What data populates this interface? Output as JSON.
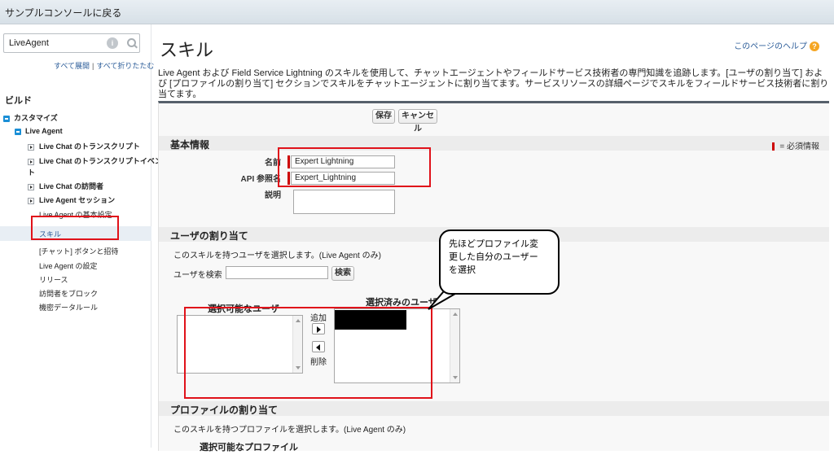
{
  "topbar": {
    "back_link": "サンプルコンソールに戻る"
  },
  "sidebar": {
    "search_value": "LiveAgent",
    "expand_all": "すべて展開",
    "separator": "|",
    "collapse_all": "すべて折りたたむ",
    "build_title": "ビルド",
    "customize": "カスタマイズ",
    "live_agent": "Live Agent",
    "items": [
      {
        "label": "Live Chat のトランスクリプト"
      },
      {
        "label": "Live Chat のトランスクリプトイベン"
      },
      {
        "label": "ト"
      },
      {
        "label": "Live Chat の訪問者"
      },
      {
        "label": "Live Agent セッション"
      },
      {
        "label": "Live Agent の基本設定"
      },
      {
        "label": "スキル"
      },
      {
        "label": "[チャット] ボタンと招待"
      },
      {
        "label": "Live Agent の設定"
      },
      {
        "label": "リリース"
      },
      {
        "label": "訪問者をブロック"
      },
      {
        "label": "機密データルール"
      }
    ]
  },
  "main": {
    "title": "スキル",
    "help_link": "このページのヘルプ",
    "description": "Live Agent および Field Service Lightning のスキルを使用して、チャットエージェントやフィールドサービス技術者の専門知識を追跡します。[ユーザの割り当て] および [プロファイルの割り当て] セクションでスキルをチャットエージェントに割り当てます。サービスリソースの詳細ページでスキルをフィールドサービス技術者に割り当てます。",
    "save_button": "保存",
    "cancel_button": "キャンセル",
    "basic_info": {
      "heading": "基本情報",
      "required_legend": "= 必須情報",
      "name_label": "名前",
      "name_value": "Expert Lightning",
      "api_label": "API 参照名",
      "api_value": "Expert_Lightning",
      "desc_label": "説明"
    },
    "user_assign": {
      "heading": "ユーザの割り当て",
      "instruction": "このスキルを持つユーザを選択します。(Live Agent のみ)",
      "search_label": "ユーザを検索",
      "search_button": "検索",
      "available_label": "選択可能なユーザ",
      "selected_label": "選択済みのユーザ",
      "add_label": "追加",
      "remove_label": "削除"
    },
    "profile_assign": {
      "heading": "プロファイルの割り当て",
      "instruction": "このスキルを持つプロファイルを選択します。(Live Agent のみ)",
      "available_label": "選択可能なプロファイル"
    }
  },
  "annotation": {
    "bubble_line1": "先ほどプロファイル変",
    "bubble_line2": "更した自分のユーザー",
    "bubble_line3": "を選択"
  },
  "colors": {
    "highlight_red": "#e0121a",
    "required_red": "#cc0000",
    "link_blue": "#2a5b98"
  }
}
